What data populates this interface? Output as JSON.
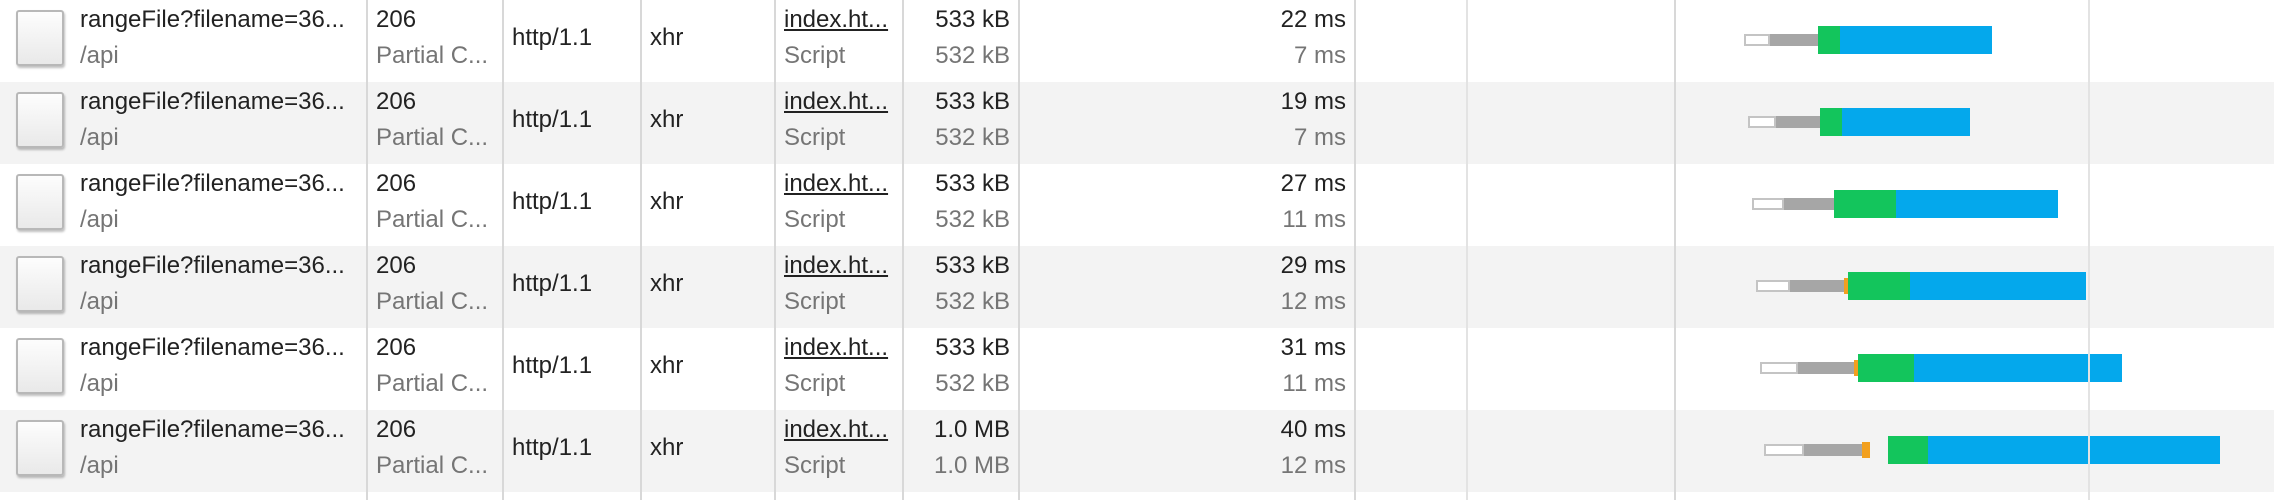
{
  "colors": {
    "queueing": "#ffffff",
    "stalled": "#a6a6a6",
    "ssl": "#f2a01f",
    "waiting": "#13c55c",
    "download": "#04a8ec"
  },
  "rows": [
    {
      "icon": "document-icon",
      "name": "rangeFile?filename=36...",
      "path": "/api",
      "status": "206",
      "status_text": "Partial C...",
      "protocol": "http/1.1",
      "type": "xhr",
      "initiator": "index.ht...",
      "initiator_type": "Script",
      "size": "533 kB",
      "resource_size": "532 kB",
      "time": "22 ms",
      "latency": "7 ms"
    },
    {
      "icon": "document-icon",
      "name": "rangeFile?filename=36...",
      "path": "/api",
      "status": "206",
      "status_text": "Partial C...",
      "protocol": "http/1.1",
      "type": "xhr",
      "initiator": "index.ht...",
      "initiator_type": "Script",
      "size": "533 kB",
      "resource_size": "532 kB",
      "time": "19 ms",
      "latency": "7 ms"
    },
    {
      "icon": "document-icon",
      "name": "rangeFile?filename=36...",
      "path": "/api",
      "status": "206",
      "status_text": "Partial C...",
      "protocol": "http/1.1",
      "type": "xhr",
      "initiator": "index.ht...",
      "initiator_type": "Script",
      "size": "533 kB",
      "resource_size": "532 kB",
      "time": "27 ms",
      "latency": "11 ms"
    },
    {
      "icon": "document-icon",
      "name": "rangeFile?filename=36...",
      "path": "/api",
      "status": "206",
      "status_text": "Partial C...",
      "protocol": "http/1.1",
      "type": "xhr",
      "initiator": "index.ht...",
      "initiator_type": "Script",
      "size": "533 kB",
      "resource_size": "532 kB",
      "time": "29 ms",
      "latency": "12 ms"
    },
    {
      "icon": "document-icon",
      "name": "rangeFile?filename=36...",
      "path": "/api",
      "status": "206",
      "status_text": "Partial C...",
      "protocol": "http/1.1",
      "type": "xhr",
      "initiator": "index.ht...",
      "initiator_type": "Script",
      "size": "533 kB",
      "resource_size": "532 kB",
      "time": "31 ms",
      "latency": "11 ms"
    },
    {
      "icon": "document-icon",
      "name": "rangeFile?filename=36...",
      "path": "/api",
      "status": "206",
      "status_text": "Partial C...",
      "protocol": "http/1.1",
      "type": "xhr",
      "initiator": "index.ht...",
      "initiator_type": "Script",
      "size": "1.0 MB",
      "resource_size": "1.0 MB",
      "time": "40 ms",
      "latency": "12 ms"
    }
  ]
}
